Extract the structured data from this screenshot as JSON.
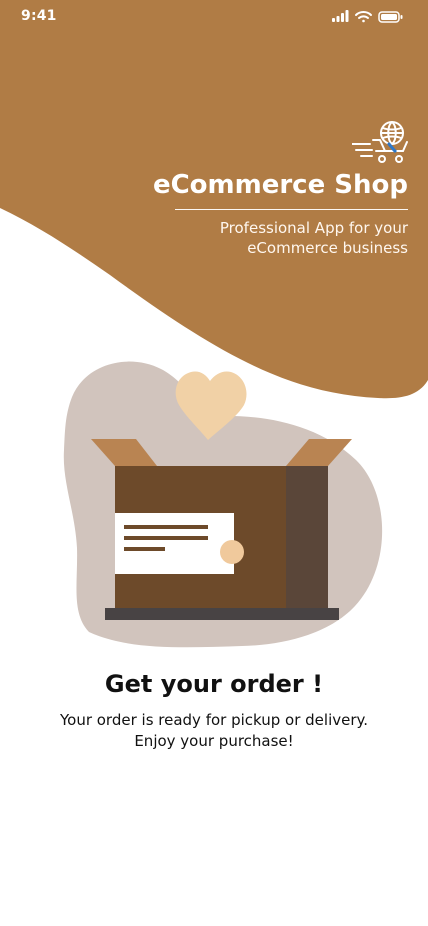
{
  "status_bar": {
    "time": "9:41",
    "icons": [
      "signal-icon",
      "wifi-icon",
      "battery-icon"
    ]
  },
  "brand": {
    "logo_icon": "shopping-cart-globe-icon",
    "title": "eCommerce Shop",
    "subtitle_line1": "Professional App for your",
    "subtitle_line2": "eCommerce business"
  },
  "illustration": {
    "type": "open-box-heart-illustration",
    "icons": [
      "heart-icon",
      "package-box-icon",
      "shipping-label-icon"
    ]
  },
  "content": {
    "headline": "Get your order !",
    "body_line1": "Your order is ready for pickup or delivery.",
    "body_line2": "Enjoy your purchase!"
  },
  "colors": {
    "brand_brown": "#B07C45",
    "blob_taupe": "#D1C4BD",
    "heart_peach": "#F1D1A6",
    "box_front": "#6D4A2A",
    "box_side": "#5A4639",
    "box_flap": "#B98452",
    "box_base": "#484344",
    "label_white": "#FFFFFF",
    "label_dot": "#F0C99C",
    "text_dark": "#111111"
  }
}
